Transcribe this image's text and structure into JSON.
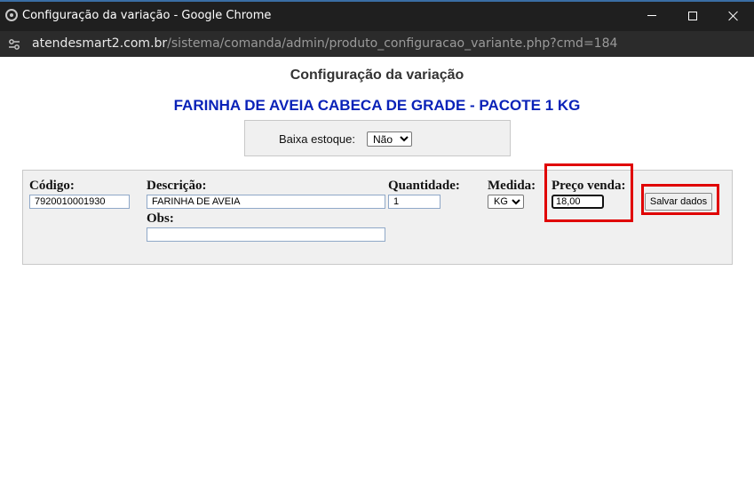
{
  "window": {
    "title": "Configuração da variação - Google Chrome",
    "host": "atendesmart2.com.br",
    "path": "/sistema/comanda/admin/produto_configuracao_variante.php?cmd=184"
  },
  "page": {
    "heading": "Configuração da variação",
    "product_name": "FARINHA DE AVEIA CABECA DE GRADE - PACOTE 1 KG"
  },
  "stock": {
    "label": "Baixa estoque:",
    "selected": "Não"
  },
  "form": {
    "codigo_label": "Código:",
    "codigo_value": "7920010001930",
    "descricao_label": "Descrição:",
    "descricao_value": "FARINHA DE AVEIA",
    "obs_label": "Obs:",
    "obs_value": "",
    "quantidade_label": "Quantidade:",
    "quantidade_value": "1",
    "medida_label": "Medida:",
    "medida_selected": "KG",
    "preco_label": "Preço venda:",
    "preco_value": "18,00",
    "save_label": "Salvar dados"
  },
  "colors": {
    "product_name": "#0a22b8",
    "highlight": "#e00000"
  }
}
